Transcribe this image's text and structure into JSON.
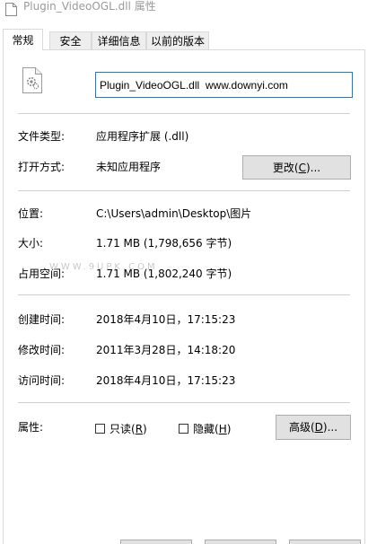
{
  "window": {
    "title": "Plugin_VideoOGL.dll 属性"
  },
  "tabs": [
    {
      "label": "常规",
      "active": true
    },
    {
      "label": "安全",
      "active": false
    },
    {
      "label": "详细信息",
      "active": false
    },
    {
      "label": "以前的版本",
      "active": false
    }
  ],
  "file": {
    "name_value": "Plugin_VideoOGL.dll  www.downyi.com",
    "icon": "dll-file-gear-icon"
  },
  "type": {
    "label": "文件类型:",
    "value": "应用程序扩展 (.dll)"
  },
  "opens_with": {
    "label": "打开方式:",
    "value": "未知应用程序",
    "change_button": "更改(C)...",
    "change_button_pre": "更改(",
    "change_button_key": "C",
    "change_button_post": ")..."
  },
  "location": {
    "label": "位置:",
    "value": "C:\\Users\\admin\\Desktop\\图片"
  },
  "size": {
    "label": "大小:",
    "value": "1.71 MB (1,798,656 字节)"
  },
  "size_on_disk": {
    "label": "占用空间:",
    "value": "1.71 MB (1,802,240 字节)"
  },
  "created": {
    "label": "创建时间:",
    "value": "2018年4月10日，17:15:23"
  },
  "modified": {
    "label": "修改时间:",
    "value": "2011年3月28日，14:18:20"
  },
  "accessed": {
    "label": "访问时间:",
    "value": "2018年4月10日，17:15:23"
  },
  "attributes": {
    "label": "属性:",
    "readonly_pre": "只读(",
    "readonly_key": "R",
    "readonly_post": ")",
    "hidden_pre": "隐藏(",
    "hidden_key": "H",
    "hidden_post": ")",
    "readonly_checked": false,
    "hidden_checked": false,
    "advanced_pre": "高级(",
    "advanced_key": "D",
    "advanced_post": ")..."
  },
  "watermark": "WWW.9UPK.COM",
  "colors": {
    "accent_border": "#1979ca",
    "button_bg": "#e1e1e1",
    "separator": "#cfcfcf",
    "title_text": "#9a9a9a"
  }
}
